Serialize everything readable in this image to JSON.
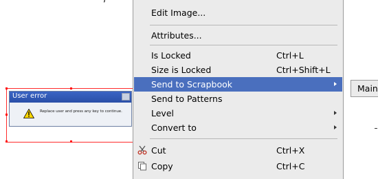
{
  "background_fragment": ", ",
  "canvas_dialog": {
    "title": "User error",
    "message": "Replace user and press any key to continue."
  },
  "context_menu": {
    "items": [
      {
        "label": "Edit Image...",
        "shortcut": ""
      },
      {
        "label": "Attributes...",
        "shortcut": ""
      },
      {
        "label": "Is Locked",
        "shortcut": "Ctrl+L"
      },
      {
        "label": "Size is Locked",
        "shortcut": "Ctrl+Shift+L"
      },
      {
        "label": "Send to Scrapbook",
        "shortcut": "",
        "submenu": true,
        "highlighted": true
      },
      {
        "label": "Send to Patterns",
        "shortcut": ""
      },
      {
        "label": "Level",
        "shortcut": "",
        "submenu": true
      },
      {
        "label": "Convert to",
        "shortcut": "",
        "submenu": true
      },
      {
        "label": "Cut",
        "shortcut": "Ctrl+X",
        "icon": "scissors-icon"
      },
      {
        "label": "Copy",
        "shortcut": "Ctrl+C",
        "icon": "copy-icon"
      }
    ]
  },
  "submenu": {
    "label": "Main"
  },
  "colors": {
    "menu_bg": "#ebebeb",
    "highlight_bg": "#4a6fbe",
    "dialog_titlebar": "#2a4fa8",
    "selection_handles": "#ff0000"
  }
}
